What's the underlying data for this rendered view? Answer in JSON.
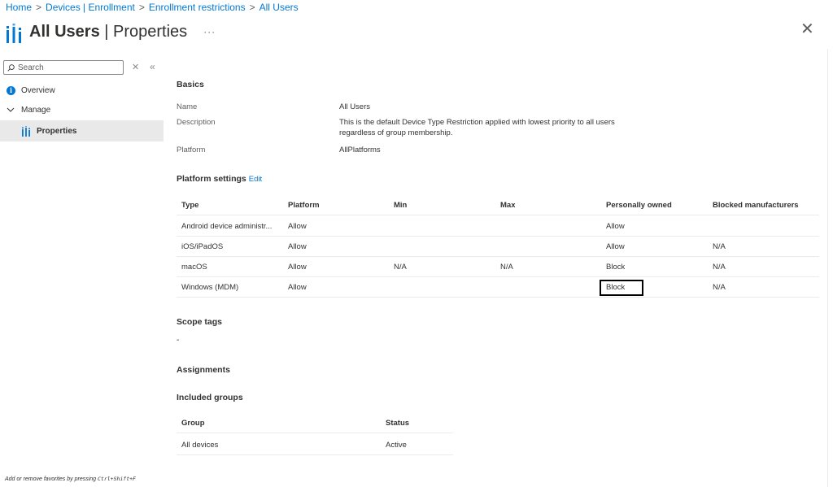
{
  "breadcrumb": [
    "Home",
    "Devices | Enrollment",
    "Enrollment restrictions",
    "All Users"
  ],
  "header": {
    "title_bold": "All Users",
    "title_sep": " | ",
    "title_rest": "Properties",
    "more": "···",
    "close": "✕"
  },
  "sidebar": {
    "search_placeholder": "Search",
    "clear": "✕",
    "collapse": "«",
    "items": [
      {
        "label": "Overview",
        "icon": "info-icon"
      },
      {
        "label": "Manage",
        "icon": "chevron-down-icon"
      },
      {
        "label": "Properties",
        "icon": "properties-icon",
        "selected": true
      }
    ],
    "favorites_hint_prefix": "Add or remove favorites by pressing ",
    "favorites_hint_keys": "Ctrl+Shift+F"
  },
  "basics": {
    "title": "Basics",
    "name_label": "Name",
    "name_value": "All Users",
    "description_label": "Description",
    "description_value": "This is the default Device Type Restriction applied with lowest priority to all users regardless of group membership.",
    "platform_label": "Platform",
    "platform_value": "AllPlatforms"
  },
  "platform_settings": {
    "title": "Platform settings",
    "edit": "Edit",
    "columns": [
      "Type",
      "Platform",
      "Min",
      "Max",
      "Personally owned",
      "Blocked manufacturers"
    ],
    "rows": [
      [
        "Android device administr...",
        "Allow",
        "",
        "",
        "Allow",
        ""
      ],
      [
        "iOS/iPadOS",
        "Allow",
        "",
        "",
        "Allow",
        "N/A"
      ],
      [
        "macOS",
        "Allow",
        "N/A",
        "N/A",
        "Block",
        "N/A"
      ],
      [
        "Windows (MDM)",
        "Allow",
        "",
        "",
        "Block",
        "N/A"
      ]
    ]
  },
  "scope_tags": {
    "title": "Scope tags",
    "value": "-"
  },
  "assignments": {
    "title": "Assignments"
  },
  "included_groups": {
    "title": "Included groups",
    "columns": [
      "Group",
      "Status"
    ],
    "rows": [
      [
        "All devices",
        "Active"
      ]
    ]
  },
  "colors": {
    "accent": "#0078d4",
    "selected_bg": "#e9e9e9",
    "highlight_border": "#000000"
  }
}
